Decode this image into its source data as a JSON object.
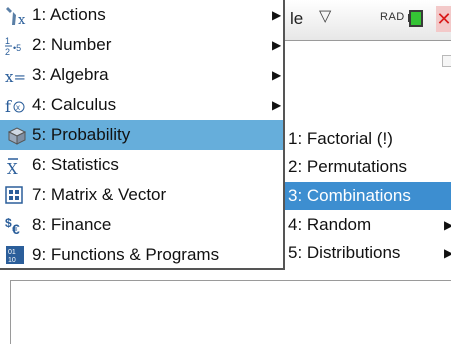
{
  "status": {
    "doc_title_partial": "le",
    "angle_mode": "RAD"
  },
  "menu": {
    "items": [
      {
        "icon": "tools-icon",
        "label": "1: Actions",
        "has_submenu": true
      },
      {
        "icon": "fraction-icon",
        "label": "2: Number",
        "has_submenu": true
      },
      {
        "icon": "algebra-icon",
        "label": "3: Algebra",
        "has_submenu": true
      },
      {
        "icon": "calculus-icon",
        "label": "4: Calculus",
        "has_submenu": true
      },
      {
        "icon": "dice-icon",
        "label": "5: Probability",
        "has_submenu": true,
        "selected": true
      },
      {
        "icon": "xbar-icon",
        "label": "6: Statistics",
        "has_submenu": false
      },
      {
        "icon": "matrix-icon",
        "label": "7: Matrix & Vector",
        "has_submenu": false
      },
      {
        "icon": "finance-icon",
        "label": "8: Finance",
        "has_submenu": false
      },
      {
        "icon": "functions-icon",
        "label": "9: Functions & Programs",
        "has_submenu": false
      }
    ]
  },
  "submenu": {
    "items": [
      {
        "label": "1: Factorial (!)",
        "has_submenu": false
      },
      {
        "label": "2: Permutations",
        "has_submenu": false
      },
      {
        "label": "3: Combinations",
        "has_submenu": false,
        "selected": true
      },
      {
        "label": "4: Random",
        "has_submenu": true
      },
      {
        "label": "5: Distributions",
        "has_submenu": true
      }
    ]
  },
  "colors": {
    "menu_highlight": "#66aedb",
    "submenu_highlight": "#3d8ed0"
  }
}
